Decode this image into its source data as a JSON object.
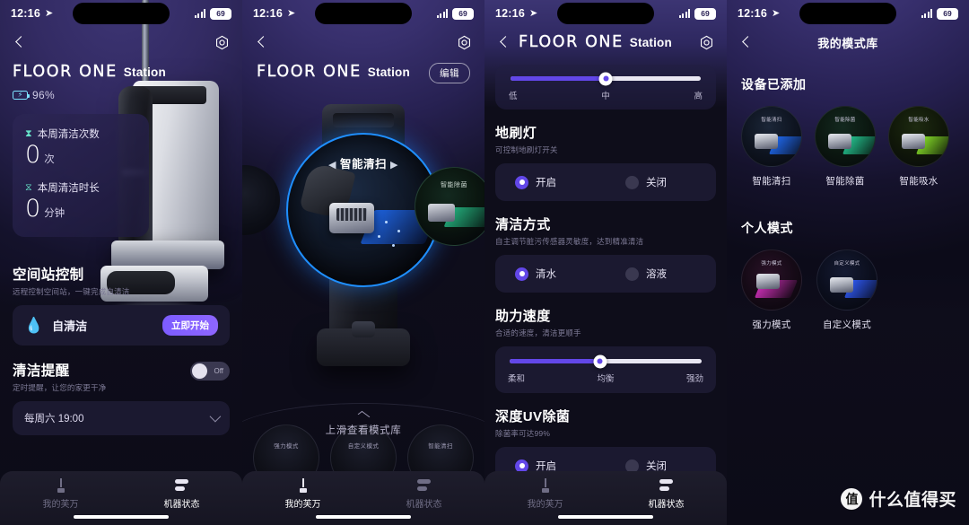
{
  "statusbar": {
    "time": "12:16",
    "battery": "69",
    "location_icon": "location-arrow-icon"
  },
  "panel1": {
    "back_icon": "back-chevron-icon",
    "gear_icon": "gear-icon",
    "brand_main": "FLOOR ONE",
    "brand_sub": "Station",
    "battery_percent": "96%",
    "stats": [
      {
        "icon": "hourglass-icon",
        "label": "本周清洁次数",
        "value": "0",
        "unit": "次"
      },
      {
        "icon": "timer-icon",
        "label": "本周清洁时长",
        "value": "0",
        "unit": "分钟"
      }
    ],
    "station_control": {
      "title": "空间站控制",
      "subtitle": "远程控制空间站，一键完成自清洁",
      "card_icon": "water-drop-icon",
      "card_label": "自清洁",
      "action_label": "立即开始"
    },
    "reminder": {
      "title": "清洁提醒",
      "subtitle": "定时提醒，让您的家更干净",
      "toggle_state": "Off",
      "schedule": "每周六 19:00",
      "chevron_icon": "chevron-down-icon"
    },
    "tabs": [
      {
        "label": "我的芙万",
        "icon": "vacuum-icon",
        "active": false
      },
      {
        "label": "机器状态",
        "icon": "status-bars-icon",
        "active": true
      }
    ]
  },
  "panel2": {
    "back_icon": "back-chevron-icon",
    "gear_icon": "gear-icon",
    "brand_main": "FLOOR ONE",
    "brand_sub": "Station",
    "edit_label": "编辑",
    "active_mode": "智能清扫",
    "arrow_left": "◀",
    "arrow_right": "▶",
    "side_mode": "智能除菌",
    "swipe_hint": "上滑查看模式库",
    "mini_modes": [
      "强力模式",
      "自定义模式",
      "智能清扫"
    ],
    "tabs": [
      {
        "label": "我的芙万",
        "icon": "vacuum-icon",
        "active": true
      },
      {
        "label": "机器状态",
        "icon": "status-bars-icon",
        "active": false
      }
    ]
  },
  "panel3": {
    "back_icon": "back-chevron-icon",
    "gear_icon": "gear-icon",
    "brand_main": "FLOOR ONE",
    "brand_sub": "Station",
    "top_slider": {
      "low": "低",
      "mid": "中",
      "high": "高",
      "percent": 50
    },
    "sections": [
      {
        "title": "地刷灯",
        "subtitle": "可控制地刷灯开关",
        "type": "radio",
        "options": [
          {
            "label": "开启",
            "selected": true
          },
          {
            "label": "关闭",
            "selected": false
          }
        ]
      },
      {
        "title": "清洁方式",
        "subtitle": "自主调节脏污传感器灵敏度，达到精准清洁",
        "type": "radio",
        "options": [
          {
            "label": "清水",
            "selected": true
          },
          {
            "label": "溶液",
            "selected": false
          }
        ]
      },
      {
        "title": "助力速度",
        "subtitle": "合适的速度，清洁更顺手",
        "type": "slider",
        "slider": {
          "low": "柔和",
          "mid": "均衡",
          "high": "强劲",
          "percent": 47
        }
      },
      {
        "title": "深度UV除菌",
        "subtitle": "除菌率可达99%",
        "type": "radio",
        "options": [
          {
            "label": "开启",
            "selected": true
          },
          {
            "label": "关闭",
            "selected": false
          }
        ]
      }
    ],
    "tabs": [
      {
        "label": "我的芙万",
        "icon": "vacuum-icon",
        "active": false
      },
      {
        "label": "机器状态",
        "icon": "status-bars-icon",
        "active": true
      }
    ]
  },
  "panel4": {
    "back_icon": "back-chevron-icon",
    "title": "我的模式库",
    "device_section_title": "设备已添加",
    "device_modes": [
      {
        "label": "智能清扫",
        "cap": "智能清扫",
        "color": "#1f6eff"
      },
      {
        "label": "智能除菌",
        "cap": "智能除菌",
        "color": "#25d19a"
      },
      {
        "label": "智能吸水",
        "cap": "智能吸水",
        "color": "#8ce82a"
      }
    ],
    "personal_section_title": "个人模式",
    "personal_modes": [
      {
        "label": "强力模式",
        "cap": "强力模式",
        "color": "#e033c8"
      },
      {
        "label": "自定义模式",
        "cap": "自定义模式",
        "color": "#2f5cff"
      }
    ]
  },
  "watermark": {
    "logo_char": "值",
    "text": "什么值得买"
  }
}
